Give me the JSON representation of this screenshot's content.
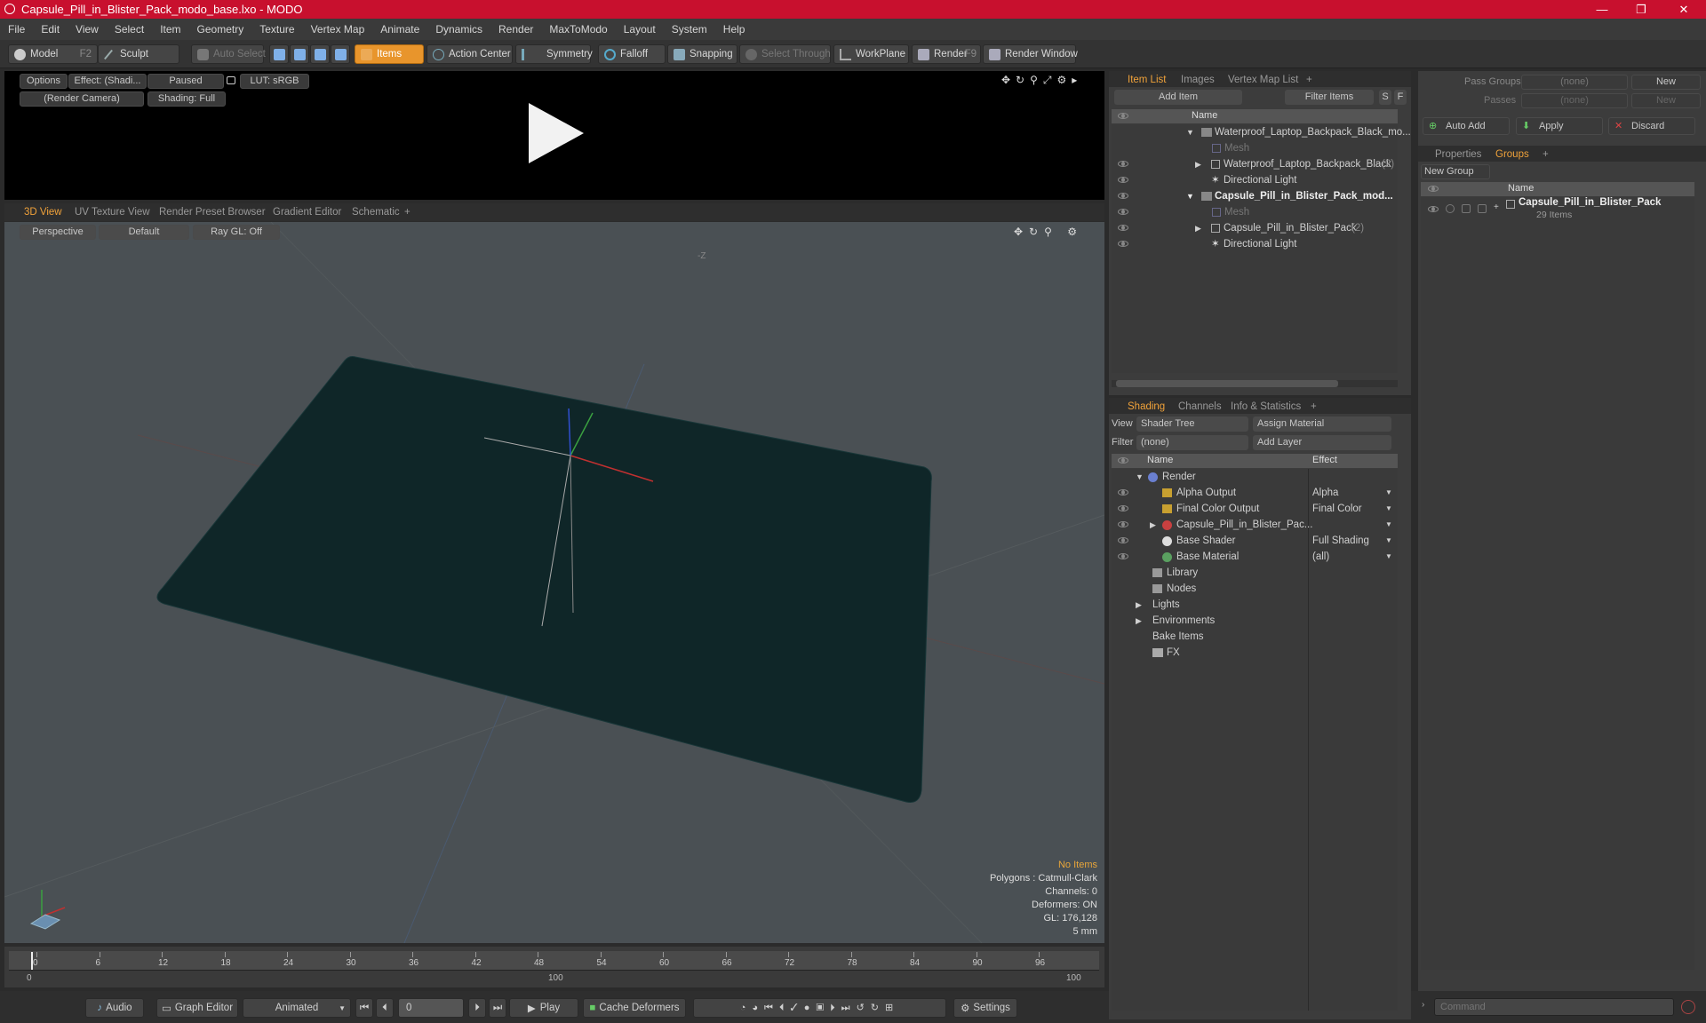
{
  "window": {
    "title": "Capsule_Pill_in_Blister_Pack_modo_base.lxo - MODO",
    "minimize": "—",
    "maximize": "❐",
    "close": "✕"
  },
  "menu": [
    "File",
    "Edit",
    "View",
    "Select",
    "Item",
    "Geometry",
    "Texture",
    "Vertex Map",
    "Animate",
    "Dynamics",
    "Render",
    "MaxToModo",
    "Layout",
    "System",
    "Help"
  ],
  "toolbar": {
    "model": "Model",
    "model_key": "F2",
    "sculpt": "Sculpt",
    "auto_select": "Auto Select",
    "items": "Items",
    "action_center": "Action Center",
    "symmetry": "Symmetry",
    "falloff": "Falloff",
    "snapping": "Snapping",
    "select_through": "Select Through",
    "workplane": "WorkPlane",
    "render": "Render",
    "render_key": "F9",
    "render_window": "Render Window"
  },
  "preview": {
    "options": "Options",
    "effect": "Effect: (Shadi...",
    "paused": "Paused",
    "lut": "LUT: sRGB",
    "camera": "(Render Camera)",
    "shading": "Shading: Full"
  },
  "viewport_tabs": [
    "3D View",
    "UV Texture View",
    "Render Preset Browser",
    "Gradient Editor",
    "Schematic",
    "+"
  ],
  "viewport": {
    "perspective": "Perspective",
    "default": "Default",
    "raygl": "Ray GL: Off",
    "axis_label": "-Z"
  },
  "stats": {
    "no_items": "No Items",
    "polygons": "Polygons : Catmull-Clark",
    "channels": "Channels: 0",
    "deformers": "Deformers: ON",
    "gl": "GL: 176,128",
    "unit": "5 mm"
  },
  "timeline": {
    "ticks": [
      "0",
      "6",
      "12",
      "18",
      "24",
      "30",
      "36",
      "42",
      "48",
      "54",
      "60",
      "66",
      "72",
      "78",
      "84",
      "90",
      "96"
    ],
    "start": "0",
    "mid": "100",
    "end": "100"
  },
  "bottombar": {
    "audio": "Audio",
    "graph_editor": "Graph Editor",
    "animated": "Animated",
    "frame": "0",
    "play": "Play",
    "cache": "Cache Deformers",
    "settings": "Settings"
  },
  "itemlist": {
    "tabs": [
      "Item List",
      "Images",
      "Vertex Map List",
      "+"
    ],
    "add_item": "Add Item",
    "filter": "Filter Items",
    "s": "S",
    "f": "F",
    "col_name": "Name",
    "rows": [
      {
        "label": "Waterproof_Laptop_Backpack_Black_mo...",
        "bold": false
      },
      {
        "label": "Mesh",
        "dim": true
      },
      {
        "label": "Waterproof_Laptop_Backpack_Black",
        "count": "(2)"
      },
      {
        "label": "Directional Light"
      },
      {
        "label": "Capsule_Pill_in_Blister_Pack_mod...",
        "bold": true
      },
      {
        "label": "Mesh",
        "dim": true
      },
      {
        "label": "Capsule_Pill_in_Blister_Pack",
        "count": "(2)"
      },
      {
        "label": "Directional Light"
      }
    ]
  },
  "shading": {
    "tabs": [
      "Shading",
      "Channels",
      "Info & Statistics",
      "+"
    ],
    "view_label": "View",
    "view_value": "Shader Tree",
    "assign": "Assign Material",
    "filter_label": "Filter",
    "filter_value": "(none)",
    "add_layer": "Add Layer",
    "col_name": "Name",
    "col_effect": "Effect",
    "rows": [
      {
        "name": "Render",
        "effect": ""
      },
      {
        "name": "Alpha Output",
        "effect": "Alpha"
      },
      {
        "name": "Final Color Output",
        "effect": "Final Color"
      },
      {
        "name": "Capsule_Pill_in_Blister_Pac...",
        "effect": ""
      },
      {
        "name": "Base Shader",
        "effect": "Full Shading"
      },
      {
        "name": "Base Material",
        "effect": "(all)"
      },
      {
        "name": "Library",
        "effect": ""
      },
      {
        "name": "Nodes",
        "effect": ""
      },
      {
        "name": "Lights",
        "effect": ""
      },
      {
        "name": "Environments",
        "effect": ""
      },
      {
        "name": "Bake Items",
        "effect": ""
      },
      {
        "name": "FX",
        "effect": ""
      }
    ]
  },
  "groups": {
    "pass_groups": "Pass Groups",
    "passes": "Passes",
    "none": "(none)",
    "new": "New",
    "auto_add": "Auto Add",
    "apply": "Apply",
    "discard": "Discard",
    "tabs": [
      "Properties",
      "Groups",
      "+"
    ],
    "new_group": "New Group",
    "col_name": "Name",
    "group_name": "Capsule_Pill_in_Blister_Pack",
    "group_count": "29 Items"
  },
  "command": {
    "placeholder": "Command"
  }
}
